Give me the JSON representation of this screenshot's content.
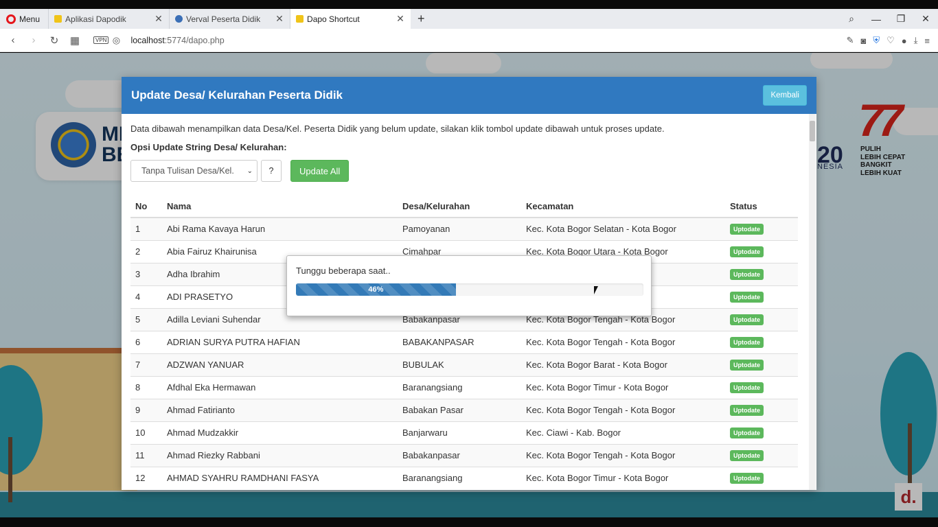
{
  "browser": {
    "menu_label": "Menu",
    "tabs": [
      {
        "title": "Aplikasi Dapodik",
        "active": false
      },
      {
        "title": "Verval Peserta Didik",
        "active": false
      },
      {
        "title": "Dapo Shortcut",
        "active": true
      }
    ],
    "new_tab_icon": "plus-icon",
    "vpn_label": "VPN",
    "url_host": "localhost",
    "url_path": ":5774/dapo.php"
  },
  "background": {
    "logo_text": "ME\nBE",
    "g20_text": "20",
    "g20_sub": "NESIA",
    "anniversary_text": "77",
    "slogan": "PULIH\nLEBIH CEPAT\nBANGKIT\nLEBIH KUAT",
    "watermark": "d."
  },
  "panel": {
    "title": "Update Desa/ Kelurahan Peserta Didik",
    "back_button": "Kembali",
    "description": "Data dibawah menampilkan data Desa/Kel. Peserta Didik yang belum update, silakan klik tombol update dibawah untuk proses update.",
    "option_label": "Opsi Update String Desa/ Kelurahan:",
    "select_value": "Tanpa Tulisan Desa/Kel.",
    "help_button": "?",
    "update_all_button": "Update All",
    "table": {
      "headers": [
        "No",
        "Nama",
        "Desa/Kelurahan",
        "Kecamatan",
        "Status"
      ],
      "rows": [
        {
          "no": "1",
          "nama": "Abi Rama Kavaya Harun",
          "desa": "Pamoyanan",
          "kecamatan": "Kec. Kota Bogor Selatan - Kota Bogor",
          "status": "Uptodate"
        },
        {
          "no": "2",
          "nama": "Abia Fairuz Khairunisa",
          "desa": "Cimahpar",
          "kecamatan": "Kec. Kota Bogor Utara - Kota Bogor",
          "status": "Uptodate"
        },
        {
          "no": "3",
          "nama": "Adha Ibrahim",
          "desa": "",
          "kecamatan": "gor",
          "status": "Uptodate"
        },
        {
          "no": "4",
          "nama": "ADI PRASETYO",
          "desa": "",
          "kecamatan": "gor",
          "status": "Uptodate"
        },
        {
          "no": "5",
          "nama": "Adilla Leviani Suhendar",
          "desa": "Babakanpasar",
          "kecamatan": "Kec. Kota Bogor Tengah - Kota Bogor",
          "status": "Uptodate"
        },
        {
          "no": "6",
          "nama": "ADRIAN SURYA PUTRA HAFIAN",
          "desa": "BABAKANPASAR",
          "kecamatan": "Kec. Kota Bogor Tengah - Kota Bogor",
          "status": "Uptodate"
        },
        {
          "no": "7",
          "nama": "ADZWAN YANUAR",
          "desa": "BUBULAK",
          "kecamatan": "Kec. Kota Bogor Barat - Kota Bogor",
          "status": "Uptodate"
        },
        {
          "no": "8",
          "nama": "Afdhal Eka Hermawan",
          "desa": "Baranangsiang",
          "kecamatan": "Kec. Kota Bogor Timur - Kota Bogor",
          "status": "Uptodate"
        },
        {
          "no": "9",
          "nama": "Ahmad Fatirianto",
          "desa": "Babakan Pasar",
          "kecamatan": "Kec. Kota Bogor Tengah - Kota Bogor",
          "status": "Uptodate"
        },
        {
          "no": "10",
          "nama": "Ahmad Mudzakkir",
          "desa": "Banjarwaru",
          "kecamatan": "Kec. Ciawi - Kab. Bogor",
          "status": "Uptodate"
        },
        {
          "no": "11",
          "nama": "Ahmad Riezky Rabbani",
          "desa": "Babakanpasar",
          "kecamatan": "Kec. Kota Bogor Tengah - Kota Bogor",
          "status": "Uptodate"
        },
        {
          "no": "12",
          "nama": "AHMAD SYAHRU RAMDHANI FASYA",
          "desa": "Baranangsiang",
          "kecamatan": "Kec. Kota Bogor Timur - Kota Bogor",
          "status": "Uptodate"
        }
      ]
    }
  },
  "dialog": {
    "message": "Tunggu beberapa saat..",
    "progress_label": "46%",
    "progress_fraction": 0.46
  },
  "colors": {
    "header_blue": "#3079c0",
    "success_green": "#5cb85c",
    "info_blue": "#5bc0de",
    "progress_blue": "#337ab7"
  }
}
